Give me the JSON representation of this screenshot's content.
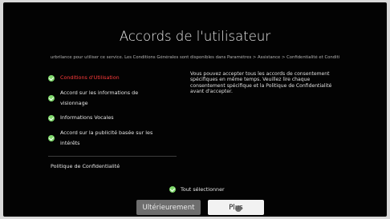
{
  "title": "Accords de l'utilisateur",
  "marquee": "urbrilance pour utiliser ce service. Les Conditions Générales sont disponibles dans Paramètres > Assistance > Confidentialité et Conditi",
  "agreements": [
    {
      "label": "Conditions d'Utilisation",
      "checked": true,
      "active": true
    },
    {
      "label": "Accord sur les informations de visionnage",
      "checked": true,
      "active": false
    },
    {
      "label": "Informations Vocales",
      "checked": true,
      "active": false
    },
    {
      "label": "Accord sur la publicité basée sur les intérêts",
      "checked": true,
      "active": false
    }
  ],
  "policy_label": "Politique de Confidentialité",
  "description": "Vous pouvez accepter tous les accords de consentement spécifiques en même temps. Veuillez lire chaque consentement spécifique et la Politique de Confidentialité avant d'accepter.",
  "select_all_label": "Tout sélectionner",
  "buttons": {
    "later": "Ultérieurement",
    "more": "Plus"
  },
  "colors": {
    "check": "#7ed96a",
    "active_text": "#ff3b3b",
    "background": "#030303"
  }
}
